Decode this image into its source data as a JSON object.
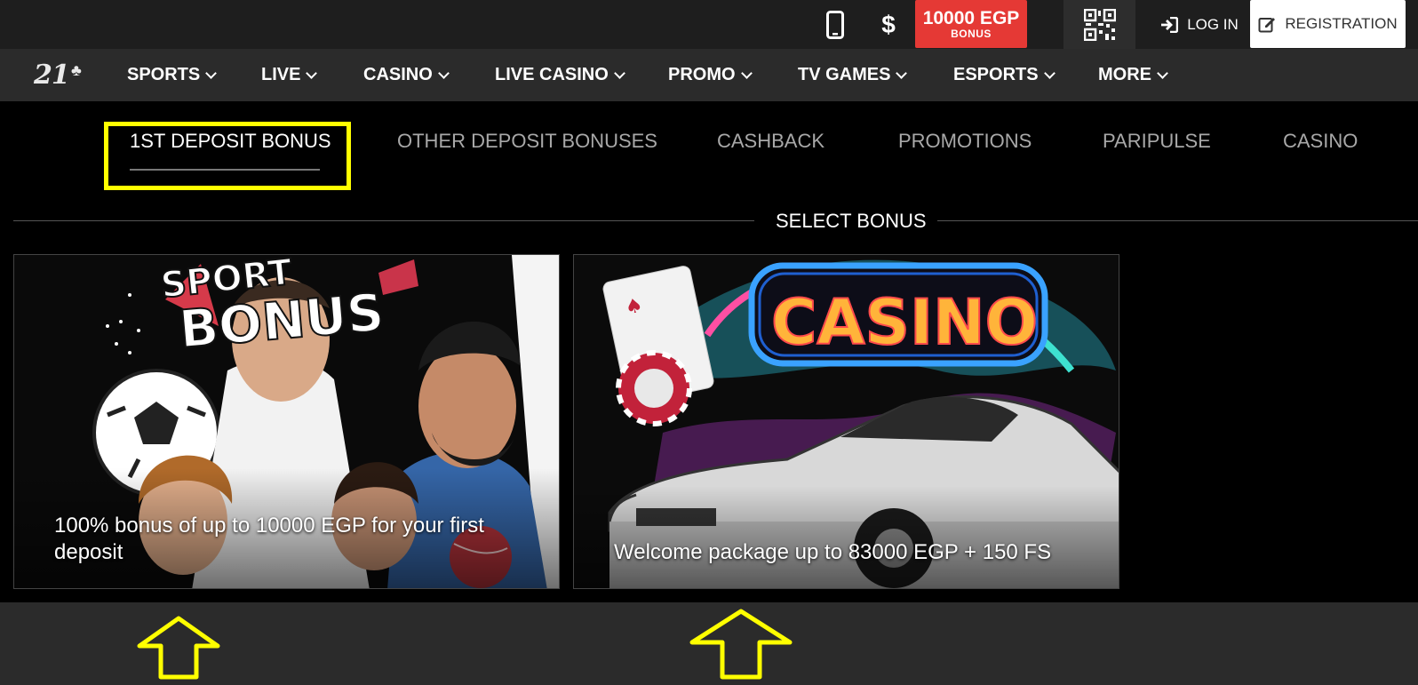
{
  "topbar": {
    "phone_icon": "mobile-phone-icon",
    "currency_symbol": "$",
    "bonus_amount": "10000 EGP",
    "bonus_label": "BONUS",
    "qr_icon": "qr-code-icon",
    "login_label": "LOG IN",
    "registration_label": "REGISTRATION"
  },
  "nav": {
    "logo_text": "21",
    "items": [
      {
        "label": "SPORTS"
      },
      {
        "label": "LIVE"
      },
      {
        "label": "CASINO"
      },
      {
        "label": "LIVE CASINO"
      },
      {
        "label": "PROMO"
      },
      {
        "label": "TV GAMES"
      },
      {
        "label": "ESPORTS"
      },
      {
        "label": "MORE"
      }
    ]
  },
  "tabs": [
    {
      "label": "1ST DEPOSIT BONUS",
      "active": true
    },
    {
      "label": "OTHER DEPOSIT BONUSES"
    },
    {
      "label": "CASHBACK"
    },
    {
      "label": "PROMOTIONS"
    },
    {
      "label": "PARIPULSE"
    },
    {
      "label": "CASINO"
    }
  ],
  "select_bonus": {
    "title": "SELECT BONUS"
  },
  "cards": [
    {
      "image_word1": "SPORT",
      "image_word2": "BONUS",
      "caption": "100% bonus of up to 10000 EGP for your first deposit"
    },
    {
      "image_word": "CASINO",
      "caption": "Welcome package up to 83000 EGP + 150 FS"
    }
  ],
  "colors": {
    "bonus_red": "#e53935",
    "highlight_yellow": "#ffff00",
    "nav_bg": "#2b2b2b",
    "topbar_bg": "#1e1e1e"
  }
}
